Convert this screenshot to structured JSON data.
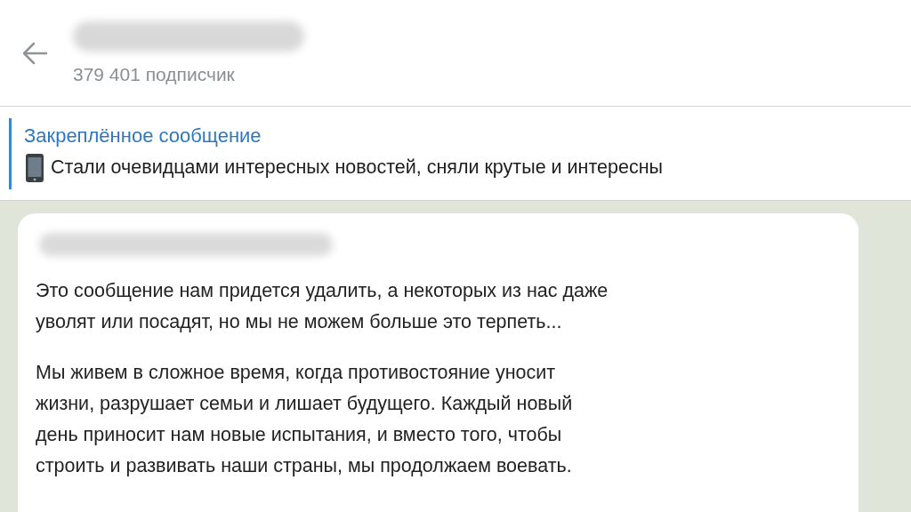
{
  "header": {
    "subscribers": "379 401 подписчик"
  },
  "pinned": {
    "title": "Закреплённое сообщение",
    "text": "Стали очевидцами интересных новостей, сняли крутые и интересны"
  },
  "message": {
    "paragraphs": [
      "Это сообщение нам придется удалить, а некоторых из нас даже\nуволят или посадят, но мы не можем больше это терпеть...",
      "Мы живем в сложное время, когда противостояние уносит\nжизни, разрушает семьи и лишает будущего. Каждый новый\nдень приносит нам новые испытания, и вместо того, чтобы\nстроить и развивать наши страны, мы продолжаем воевать."
    ]
  }
}
